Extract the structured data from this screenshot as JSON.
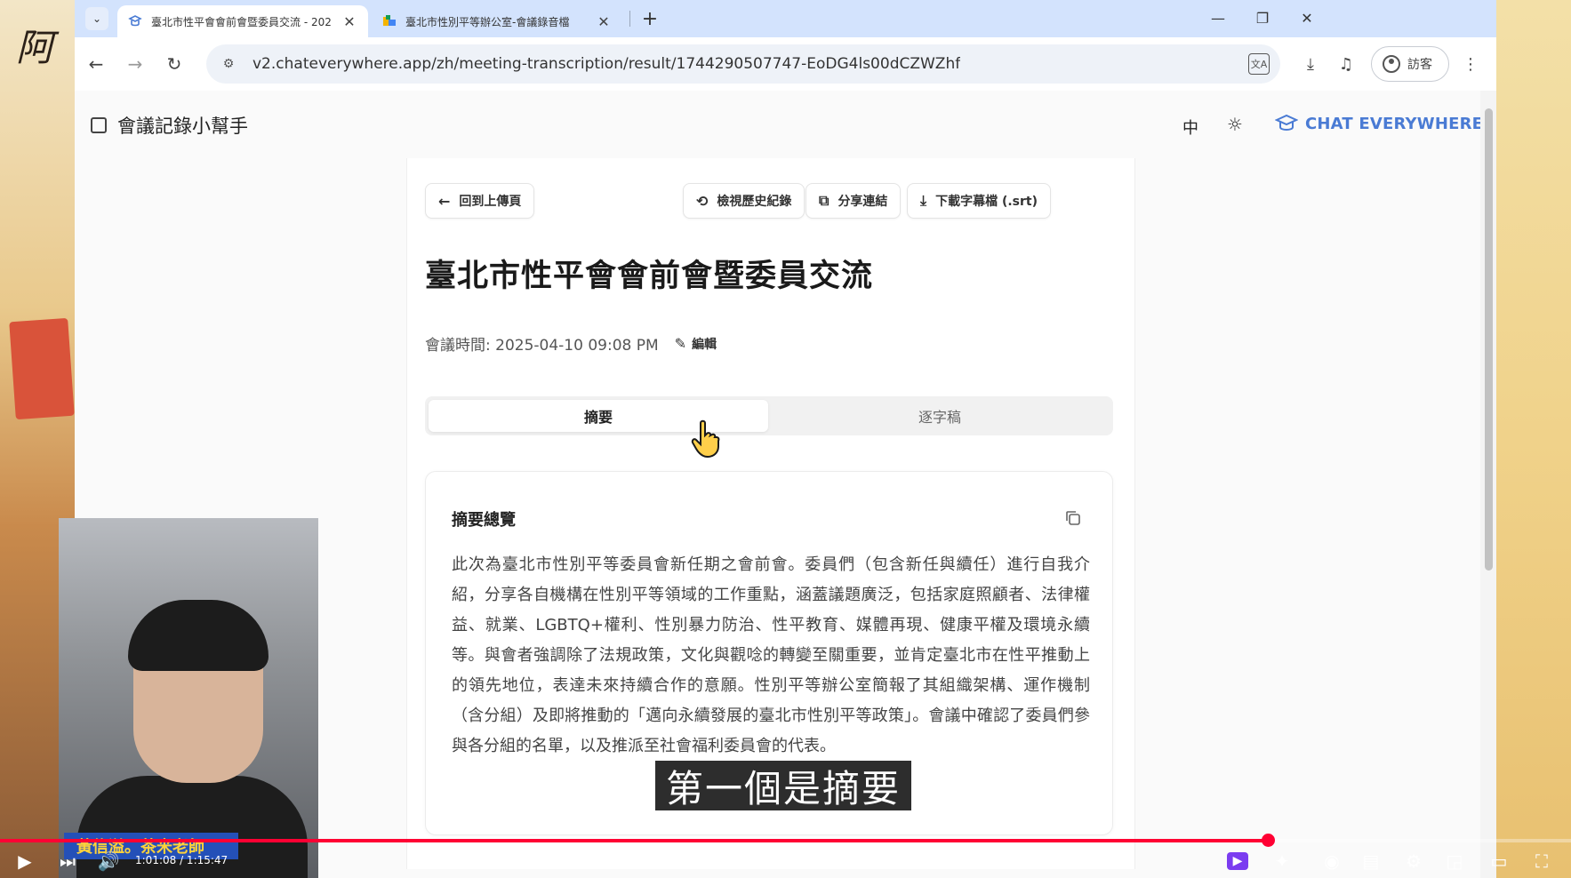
{
  "browser": {
    "tabs": [
      {
        "title": "臺北市性平會會前會暨委員交流 - 202",
        "active": true
      },
      {
        "title": "臺北市性別平等辦公室-會議錄音檔",
        "active": false
      }
    ],
    "url": "v2.chateverywhere.app/zh/meeting-transcription/result/1744290507747-EoDG4ls00dCZWZhf",
    "profile_label": "訪客"
  },
  "app": {
    "title": "會議記錄小幫手",
    "lang_toggle": "中",
    "brand": "CHAT EVERYWHERE",
    "accent_color": "#4a7bd4"
  },
  "actions": {
    "back_label": "回到上傳頁",
    "history_label": "檢視歷史紀錄",
    "share_label": "分享連結",
    "download_label": "下載字幕檔 (.srt)"
  },
  "meeting": {
    "title": "臺北市性平會會前會暨委員交流",
    "time_label": "會議時間: 2025-04-10 09:08 PM",
    "edit_label": "編輯"
  },
  "tabs": {
    "summary": "摘要",
    "transcript": "逐字稿"
  },
  "summary": {
    "heading": "摘要總覽",
    "body": "此次為臺北市性別平等委員會新任期之會前會。委員們（包含新任與續任）進行自我介紹，分享各自機構在性別平等領域的工作重點，涵蓋議題廣泛，包括家庭照顧者、法律權益、就業、LGBTQ+權利、性別暴力防治、性平教育、媒體再現、健康平權及環境永續等。與會者強調除了法規政策，文化與觀唸的轉變至關重要，並肯定臺北市在性平推動上的領先地位，表達未來持續合作的意願。性別平等辦公室簡報了其組織架構、運作機制（含分組）及即將推動的「邁向永續發展的臺北市性別平等政策」。會議中確認了委員們參與各分組的名單，以及推派至社會福利委員會的代表。"
  },
  "video": {
    "subtitle": "第一個是摘要",
    "webcam_name": "黃信溢。茶米老師",
    "time": "1:01:08 / 1:15:47",
    "progress": 0.8068,
    "progress_color": "#ff0033"
  }
}
